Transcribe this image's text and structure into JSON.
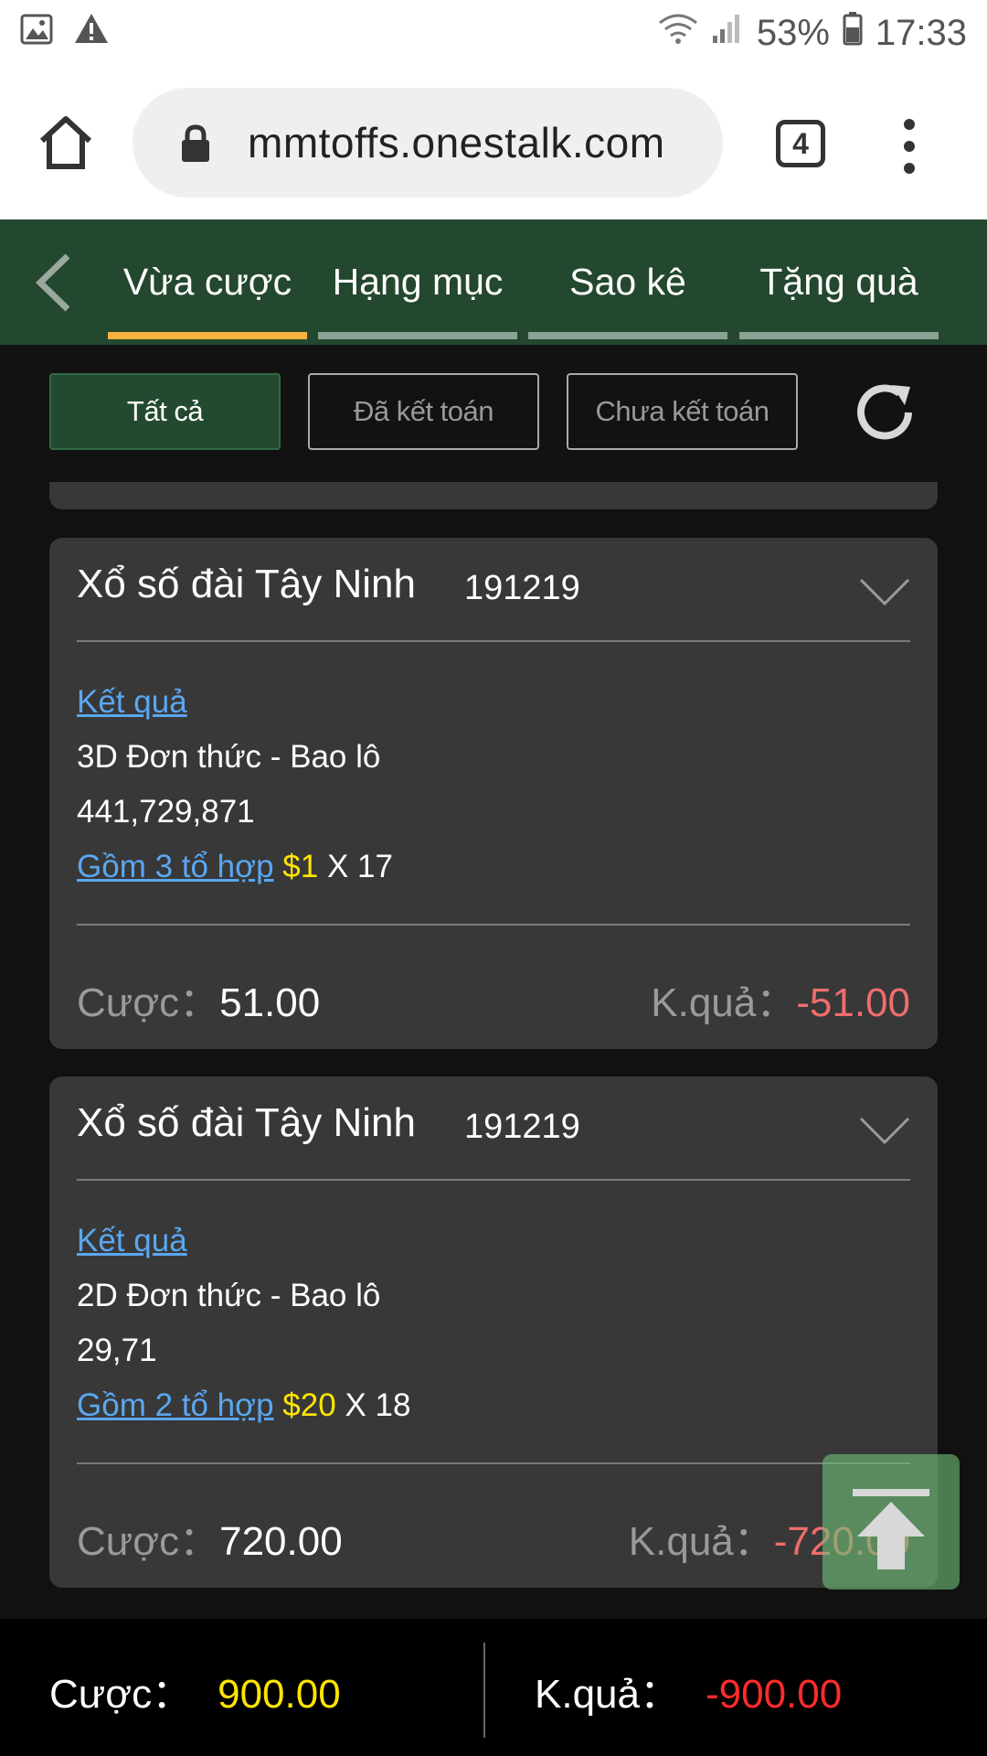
{
  "status_bar": {
    "battery": "53%",
    "time": "17:33"
  },
  "browser": {
    "url": "mmtoffs.onestalk.com",
    "tab_count": "4"
  },
  "nav": {
    "tabs": [
      {
        "label": "Vừa cược",
        "active": true
      },
      {
        "label": "Hạng mục",
        "active": false
      },
      {
        "label": "Sao kê",
        "active": false
      },
      {
        "label": "Tặng quà",
        "active": false
      }
    ]
  },
  "filters": {
    "all": "Tất cả",
    "settled": "Đã kết toán",
    "unsettled": "Chưa kết toán",
    "active": "all"
  },
  "bets": [
    {
      "title": "Xổ số đài Tây Ninh",
      "code": "191219",
      "result_link": "Kết quả",
      "type": "3D Đơn thức - Bao lô",
      "numbers": "441,729,871",
      "combo_link": "Gồm 3 tổ hợp",
      "amount": "$1",
      "multiplier": "X 17",
      "stake_label": "Cược：",
      "stake": "51.00",
      "result_label": "K.quả：",
      "result": "-51.00"
    },
    {
      "title": "Xổ số đài Tây Ninh",
      "code": "191219",
      "result_link": "Kết quả",
      "type": "2D Đơn thức - Bao lô",
      "numbers": "29,71",
      "combo_link": "Gồm 2 tổ hợp",
      "amount": "$20",
      "multiplier": "X 18",
      "stake_label": "Cược：",
      "stake": "720.00",
      "result_label": "K.quả：",
      "result": "-720.00"
    }
  ],
  "summary": {
    "stake_label": "Cược：",
    "stake": "900.00",
    "result_label": "K.quả：",
    "result": "-900.00"
  },
  "colors": {
    "nav_bg": "#23472f",
    "active_underline": "#f5b23f",
    "link": "#5aa7f0",
    "positive": "#ffe500",
    "negative": "#f06d6d"
  }
}
